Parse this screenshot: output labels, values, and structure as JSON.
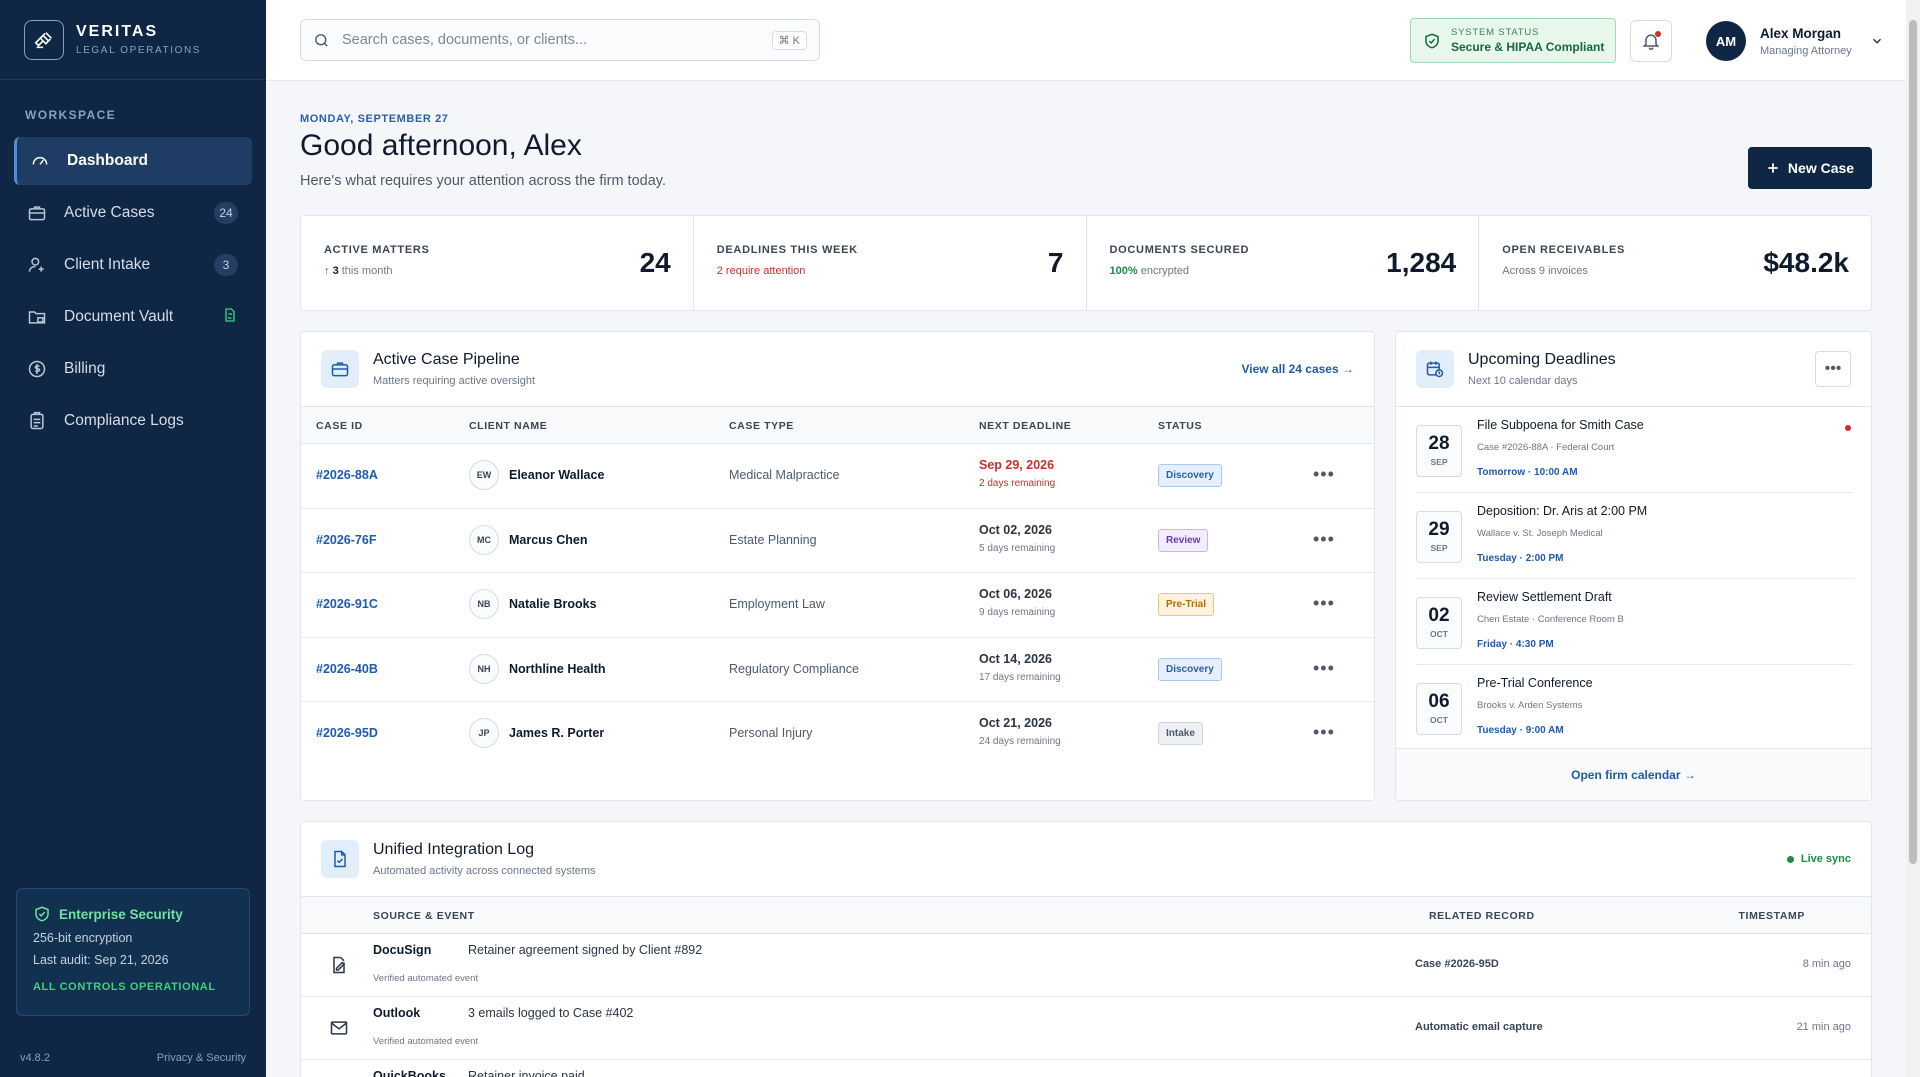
{
  "brand": {
    "name": "VERITAS",
    "subtitle": "LEGAL OPERATIONS"
  },
  "sidebar": {
    "section_label": "WORKSPACE",
    "items": [
      {
        "label": "Dashboard",
        "badge": ""
      },
      {
        "label": "Active Cases",
        "badge": "24"
      },
      {
        "label": "Client Intake",
        "badge": "3"
      },
      {
        "label": "Document Vault",
        "badge": ""
      },
      {
        "label": "Billing",
        "badge": ""
      },
      {
        "label": "Compliance Logs",
        "badge": ""
      }
    ],
    "security": {
      "title": "Enterprise Security",
      "line1": "256-bit encryption",
      "line2": "Last audit: Sep 21, 2026",
      "status": "ALL CONTROLS OPERATIONAL"
    },
    "version": "v4.8.2",
    "privacy_link": "Privacy & Security"
  },
  "topbar": {
    "search_placeholder": "Search cases, documents, or clients...",
    "shortcut": "⌘ K",
    "system_status_label": "SYSTEM STATUS",
    "system_status_value": "Secure & HIPAA Compliant",
    "user": {
      "initials": "AM",
      "name": "Alex Morgan",
      "role": "Managing Attorney"
    }
  },
  "header": {
    "date": "MONDAY, SEPTEMBER 27",
    "greeting": "Good afternoon, Alex",
    "subtitle": "Here's what requires your attention across the firm today.",
    "new_case_label": "New Case"
  },
  "stats": [
    {
      "label": "ACTIVE MATTERS",
      "sub_strong": "3",
      "sub": "this month",
      "value": "24"
    },
    {
      "label": "DEADLINES THIS WEEK",
      "sub_strong": "",
      "sub": "2 require attention",
      "value": "7"
    },
    {
      "label": "DOCUMENTS SECURED",
      "sub_strong": "100%",
      "sub": "encrypted",
      "value": "1,284"
    },
    {
      "label": "OPEN RECEIVABLES",
      "sub_strong": "",
      "sub": "Across 9 invoices",
      "value": "$48.2k"
    }
  ],
  "pipeline": {
    "title": "Active Case Pipeline",
    "subtitle": "Matters requiring active oversight",
    "view_all": "View all 24 cases →",
    "columns": [
      "CASE ID",
      "CLIENT NAME",
      "CASE TYPE",
      "NEXT DEADLINE",
      "STATUS"
    ],
    "rows": [
      {
        "id": "#2026-88A",
        "initials": "EW",
        "client": "Eleanor Wallace",
        "type": "Medical Malpractice",
        "date": "Sep 29, 2026",
        "remaining": "2 days remaining",
        "status": "Discovery"
      },
      {
        "id": "#2026-76F",
        "initials": "MC",
        "client": "Marcus Chen",
        "type": "Estate Planning",
        "date": "Oct 02, 2026",
        "remaining": "5 days remaining",
        "status": "Review"
      },
      {
        "id": "#2026-91C",
        "initials": "NB",
        "client": "Natalie Brooks",
        "type": "Employment Law",
        "date": "Oct 06, 2026",
        "remaining": "9 days remaining",
        "status": "Pre-Trial"
      },
      {
        "id": "#2026-40B",
        "initials": "NH",
        "client": "Northline Health",
        "type": "Regulatory Compliance",
        "date": "Oct 14, 2026",
        "remaining": "17 days remaining",
        "status": "Discovery"
      },
      {
        "id": "#2026-95D",
        "initials": "JP",
        "client": "James R. Porter",
        "type": "Personal Injury",
        "date": "Oct 21, 2026",
        "remaining": "24 days remaining",
        "status": "Intake"
      }
    ]
  },
  "deadlines": {
    "title": "Upcoming Deadlines",
    "subtitle": "Next 10 calendar days",
    "items": [
      {
        "day": "28",
        "month": "SEP",
        "title": "File Subpoena for Smith Case",
        "meta": "Case #2026-88A · Federal Court",
        "when": "Tomorrow · 10:00 AM"
      },
      {
        "day": "29",
        "month": "SEP",
        "title": "Deposition: Dr. Aris at 2:00 PM",
        "meta": "Wallace v. St. Joseph Medical",
        "when": "Tuesday · 2:00 PM"
      },
      {
        "day": "02",
        "month": "OCT",
        "title": "Review Settlement Draft",
        "meta": "Chen Estate · Conference Room B",
        "when": "Friday · 4:30 PM"
      },
      {
        "day": "06",
        "month": "OCT",
        "title": "Pre-Trial Conference",
        "meta": "Brooks v. Arden Systems",
        "when": "Tuesday · 9:00 AM"
      }
    ],
    "footer_link": "Open firm calendar →"
  },
  "integration": {
    "title": "Unified Integration Log",
    "subtitle": "Automated activity across connected systems",
    "live": "Live sync",
    "columns": [
      "SOURCE & EVENT",
      "RELATED RECORD",
      "TIMESTAMP"
    ],
    "rows": [
      {
        "source": "DocuSign",
        "event": "Retainer agreement signed by Client #892",
        "verified": "Verified automated event",
        "related": "Case #2026-95D",
        "time": "8 min ago"
      },
      {
        "source": "Outlook",
        "event": "3 emails logged to Case #402",
        "verified": "Verified automated event",
        "related": "Automatic email capture",
        "time": "21 min ago"
      },
      {
        "source": "QuickBooks",
        "event": "Retainer invoice paid",
        "verified": "",
        "related": "",
        "time": ""
      }
    ]
  },
  "colors": {
    "sidebar_bg": "#0f2744",
    "accent": "#1d5bb0",
    "success": "#1a8c46",
    "danger": "#cc2d2d"
  }
}
